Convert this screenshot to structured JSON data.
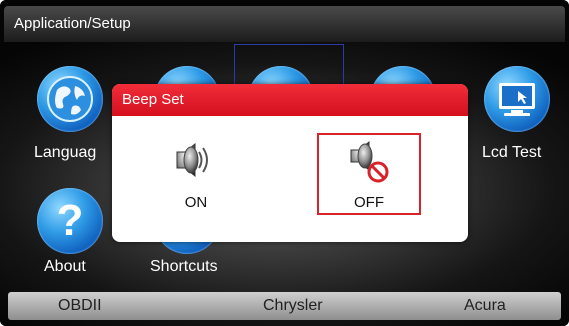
{
  "header": {
    "title": "Application/Setup"
  },
  "apps": [
    {
      "label": "Languag",
      "icon": "globe-icon"
    },
    {
      "label": "Lcd Test",
      "icon": "monitor-icon"
    },
    {
      "label": "About",
      "icon": "question-icon"
    },
    {
      "label": "Shortcuts",
      "icon": "shortcuts-icon"
    }
  ],
  "dialog": {
    "title": "Beep Set",
    "options": [
      {
        "label": "ON",
        "icon": "speaker-on-icon"
      },
      {
        "label": "OFF",
        "icon": "speaker-off-icon"
      }
    ],
    "selected": "OFF"
  },
  "tabs": [
    "OBDII",
    "Chrysler",
    "Acura"
  ],
  "colors": {
    "dialog_header": "#e51b2a",
    "selection_frame": "#d8232a",
    "icon_blue": "#1f7fd6"
  }
}
